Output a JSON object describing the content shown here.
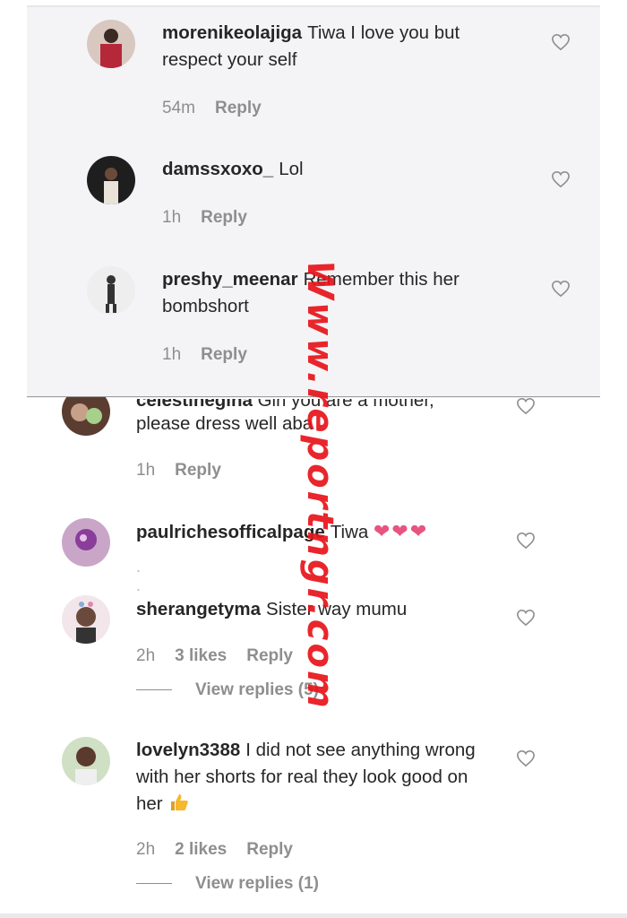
{
  "comments": [
    {
      "username": "morenikeolajiga",
      "text": "Tiwa I love you but respect your self",
      "time": "54m",
      "reply_label": "Reply"
    },
    {
      "username": "damssxoxo_",
      "text": "Lol",
      "time": "1h",
      "reply_label": "Reply"
    },
    {
      "username": "preshy_meenar",
      "text": "Remember this her bombshort",
      "time": "1h",
      "reply_label": "Reply"
    },
    {
      "username": "celestinegina",
      "text_cut": "Girl you are a mother,",
      "text": "please dress well aba",
      "time": "1h",
      "reply_label": "Reply"
    },
    {
      "username": "paulrichesofficalpage",
      "text": "Tiwa",
      "emoji": "❤❤❤"
    },
    {
      "username": "sherangetyma",
      "text": "Sister way mumu",
      "time": "2h",
      "likes": "3 likes",
      "reply_label": "Reply",
      "view_replies": "View replies (5)"
    },
    {
      "username": "lovelyn3388",
      "text": "I did not see anything wrong with her shorts for real they look good on her",
      "time": "2h",
      "likes": "2 likes",
      "reply_label": "Reply",
      "view_replies": "View replies (1)"
    }
  ],
  "watermark": "Www.reportngr.com",
  "icons": {
    "like": "heart-outline-icon",
    "emoji_thumb": "thumbs-up-emoji"
  },
  "colors": {
    "watermark": "#e8141a",
    "secondary_text": "#8e8e8e",
    "emoji_heart": "#e75480"
  }
}
